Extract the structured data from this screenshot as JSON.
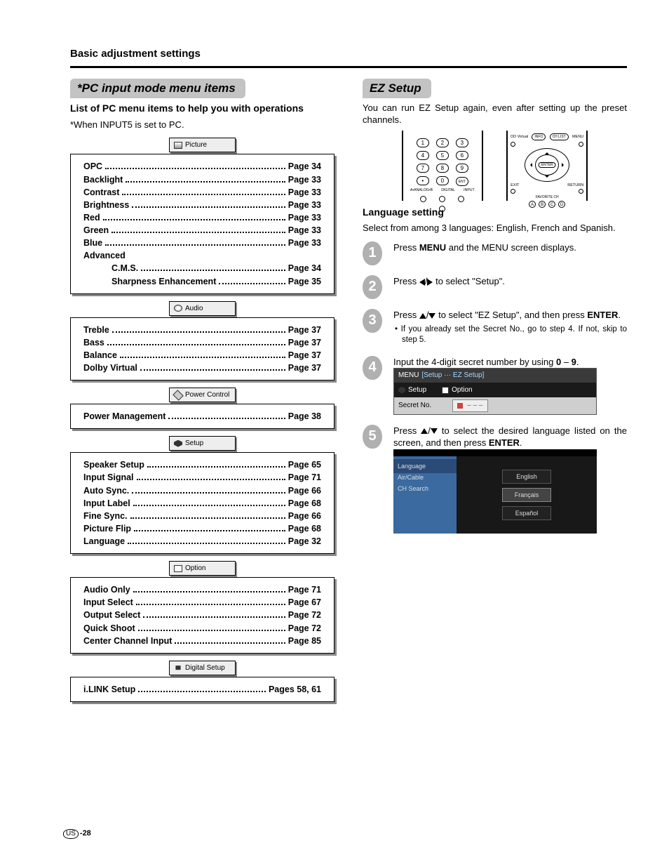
{
  "breadcrumb": "Basic adjustment settings",
  "left": {
    "section_title": "*PC input mode menu items",
    "subhead": "List of PC menu items to help you with operations",
    "note": "*When INPUT5 is set to PC.",
    "groups": [
      {
        "tab": "Picture",
        "items": [
          {
            "label": "OPC",
            "page": "Page 34"
          },
          {
            "label": "Backlight",
            "page": "Page 33"
          },
          {
            "label": "Contrast",
            "page": "Page 33"
          },
          {
            "label": "Brightness",
            "page": "Page 33"
          },
          {
            "label": "Red",
            "page": "Page 33"
          },
          {
            "label": "Green",
            "page": "Page 33"
          },
          {
            "label": "Blue",
            "page": "Page 33"
          }
        ],
        "trailer_head": "Advanced",
        "trailer": [
          {
            "label": "C.M.S.",
            "page": "Page 34"
          },
          {
            "label": "Sharpness Enhancement",
            "page": "Page 35"
          }
        ]
      },
      {
        "tab": "Audio",
        "items": [
          {
            "label": "Treble",
            "page": "Page 37"
          },
          {
            "label": "Bass",
            "page": "Page 37"
          },
          {
            "label": "Balance",
            "page": "Page 37"
          },
          {
            "label": "Dolby Virtual",
            "page": "Page 37"
          }
        ]
      },
      {
        "tab": "Power Control",
        "items": [
          {
            "label": "Power Management",
            "page": "Page 38"
          }
        ]
      },
      {
        "tab": "Setup",
        "items": [
          {
            "label": "Speaker Setup",
            "page": "Page 65"
          },
          {
            "label": "Input Signal",
            "page": "Page 71"
          },
          {
            "label": "Auto Sync.",
            "page": "Page 66"
          },
          {
            "label": "Input Label",
            "page": "Page 68"
          },
          {
            "label": "Fine Sync.",
            "page": "Page 66"
          },
          {
            "label": "Picture Flip",
            "page": "Page 68"
          },
          {
            "label": "Language",
            "page": "Page 32"
          }
        ]
      },
      {
        "tab": "Option",
        "items": [
          {
            "label": "Audio Only",
            "page": "Page 71"
          },
          {
            "label": "Input Select",
            "page": "Page 67"
          },
          {
            "label": "Output Select",
            "page": "Page 72"
          },
          {
            "label": "Quick Shoot",
            "page": "Page 72"
          },
          {
            "label": "Center Channel Input",
            "page": "Page 85"
          }
        ]
      },
      {
        "tab": "Digital Setup",
        "items": [
          {
            "label": "i.LINK Setup",
            "page": "Pages 58, 61"
          }
        ]
      }
    ]
  },
  "right": {
    "section_title": "EZ Setup",
    "intro": "You can run EZ Setup again, even after setting up the preset channels.",
    "remote_number_labels": {
      "row1": [
        "1",
        "2",
        "3"
      ],
      "row2": [
        "4",
        "5",
        "6"
      ],
      "row3": [
        "7",
        "8",
        "9"
      ],
      "row4": [
        "•",
        "0",
        "ENT"
      ],
      "bottom": [
        "A•ANALOG•B",
        "DIGITAL",
        "INPUT"
      ]
    },
    "dpad_labels": {
      "top": [
        "DD Virtual",
        "INFO",
        "CH LIST",
        "MENU"
      ],
      "center": "ENTER",
      "side": [
        "EXIT",
        "RETURN"
      ],
      "fav": "FAVORITE CH",
      "abcd": [
        "A",
        "B",
        "C",
        "D"
      ]
    },
    "lang_head": "Language setting",
    "lang_desc": "Select from among 3 languages: English, French and Spanish.",
    "steps": [
      {
        "n": "1",
        "html_parts": [
          "Press ",
          "MENU",
          " and the MENU screen displays."
        ]
      },
      {
        "n": "2",
        "html_parts": [
          "Press ",
          " to select \"Setup\"."
        ]
      },
      {
        "n": "3",
        "html_parts": [
          "Press ",
          " to select \"EZ Setup\", and then press ",
          "ENTER",
          "."
        ],
        "bullet": "If you already set the Secret No., go to step 4. If not, skip to step 5."
      },
      {
        "n": "4",
        "html_parts": [
          "Input the 4-digit secret number by using ",
          "0",
          " – ",
          "9",
          "."
        ]
      },
      {
        "n": "5",
        "html_parts": [
          "Press ",
          " to select the desired language listed on the screen, and then press ",
          "ENTER",
          "."
        ]
      }
    ],
    "osd_menu": {
      "title": "MENU",
      "crumb": "[Setup ··· EZ Setup]",
      "tabs": [
        "Setup",
        "Option"
      ],
      "row_label": "Secret No.",
      "dashes": [
        "–",
        "–",
        "–"
      ]
    },
    "osd_lang": {
      "side": [
        "Language",
        "Air/Cable",
        "CH Search"
      ],
      "langs": [
        "English",
        "Français",
        "Español"
      ]
    }
  },
  "page_number": {
    "region": "US",
    "num": "-28"
  }
}
